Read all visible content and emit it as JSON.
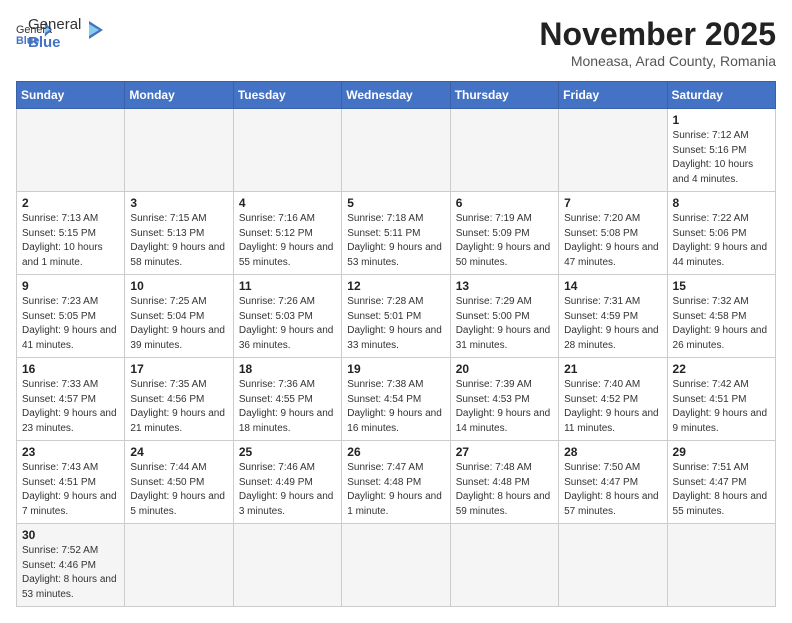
{
  "header": {
    "logo_general": "General",
    "logo_blue": "Blue",
    "month_title": "November 2025",
    "subtitle": "Moneasa, Arad County, Romania"
  },
  "weekdays": [
    "Sunday",
    "Monday",
    "Tuesday",
    "Wednesday",
    "Thursday",
    "Friday",
    "Saturday"
  ],
  "weeks": [
    [
      {
        "day": "",
        "info": ""
      },
      {
        "day": "",
        "info": ""
      },
      {
        "day": "",
        "info": ""
      },
      {
        "day": "",
        "info": ""
      },
      {
        "day": "",
        "info": ""
      },
      {
        "day": "",
        "info": ""
      },
      {
        "day": "1",
        "info": "Sunrise: 7:12 AM\nSunset: 5:16 PM\nDaylight: 10 hours\nand 4 minutes."
      }
    ],
    [
      {
        "day": "2",
        "info": "Sunrise: 7:13 AM\nSunset: 5:15 PM\nDaylight: 10 hours\nand 1 minute."
      },
      {
        "day": "3",
        "info": "Sunrise: 7:15 AM\nSunset: 5:13 PM\nDaylight: 9 hours\nand 58 minutes."
      },
      {
        "day": "4",
        "info": "Sunrise: 7:16 AM\nSunset: 5:12 PM\nDaylight: 9 hours\nand 55 minutes."
      },
      {
        "day": "5",
        "info": "Sunrise: 7:18 AM\nSunset: 5:11 PM\nDaylight: 9 hours\nand 53 minutes."
      },
      {
        "day": "6",
        "info": "Sunrise: 7:19 AM\nSunset: 5:09 PM\nDaylight: 9 hours\nand 50 minutes."
      },
      {
        "day": "7",
        "info": "Sunrise: 7:20 AM\nSunset: 5:08 PM\nDaylight: 9 hours\nand 47 minutes."
      },
      {
        "day": "8",
        "info": "Sunrise: 7:22 AM\nSunset: 5:06 PM\nDaylight: 9 hours\nand 44 minutes."
      }
    ],
    [
      {
        "day": "9",
        "info": "Sunrise: 7:23 AM\nSunset: 5:05 PM\nDaylight: 9 hours\nand 41 minutes."
      },
      {
        "day": "10",
        "info": "Sunrise: 7:25 AM\nSunset: 5:04 PM\nDaylight: 9 hours\nand 39 minutes."
      },
      {
        "day": "11",
        "info": "Sunrise: 7:26 AM\nSunset: 5:03 PM\nDaylight: 9 hours\nand 36 minutes."
      },
      {
        "day": "12",
        "info": "Sunrise: 7:28 AM\nSunset: 5:01 PM\nDaylight: 9 hours\nand 33 minutes."
      },
      {
        "day": "13",
        "info": "Sunrise: 7:29 AM\nSunset: 5:00 PM\nDaylight: 9 hours\nand 31 minutes."
      },
      {
        "day": "14",
        "info": "Sunrise: 7:31 AM\nSunset: 4:59 PM\nDaylight: 9 hours\nand 28 minutes."
      },
      {
        "day": "15",
        "info": "Sunrise: 7:32 AM\nSunset: 4:58 PM\nDaylight: 9 hours\nand 26 minutes."
      }
    ],
    [
      {
        "day": "16",
        "info": "Sunrise: 7:33 AM\nSunset: 4:57 PM\nDaylight: 9 hours\nand 23 minutes."
      },
      {
        "day": "17",
        "info": "Sunrise: 7:35 AM\nSunset: 4:56 PM\nDaylight: 9 hours\nand 21 minutes."
      },
      {
        "day": "18",
        "info": "Sunrise: 7:36 AM\nSunset: 4:55 PM\nDaylight: 9 hours\nand 18 minutes."
      },
      {
        "day": "19",
        "info": "Sunrise: 7:38 AM\nSunset: 4:54 PM\nDaylight: 9 hours\nand 16 minutes."
      },
      {
        "day": "20",
        "info": "Sunrise: 7:39 AM\nSunset: 4:53 PM\nDaylight: 9 hours\nand 14 minutes."
      },
      {
        "day": "21",
        "info": "Sunrise: 7:40 AM\nSunset: 4:52 PM\nDaylight: 9 hours\nand 11 minutes."
      },
      {
        "day": "22",
        "info": "Sunrise: 7:42 AM\nSunset: 4:51 PM\nDaylight: 9 hours\nand 9 minutes."
      }
    ],
    [
      {
        "day": "23",
        "info": "Sunrise: 7:43 AM\nSunset: 4:51 PM\nDaylight: 9 hours\nand 7 minutes."
      },
      {
        "day": "24",
        "info": "Sunrise: 7:44 AM\nSunset: 4:50 PM\nDaylight: 9 hours\nand 5 minutes."
      },
      {
        "day": "25",
        "info": "Sunrise: 7:46 AM\nSunset: 4:49 PM\nDaylight: 9 hours\nand 3 minutes."
      },
      {
        "day": "26",
        "info": "Sunrise: 7:47 AM\nSunset: 4:48 PM\nDaylight: 9 hours\nand 1 minute."
      },
      {
        "day": "27",
        "info": "Sunrise: 7:48 AM\nSunset: 4:48 PM\nDaylight: 8 hours\nand 59 minutes."
      },
      {
        "day": "28",
        "info": "Sunrise: 7:50 AM\nSunset: 4:47 PM\nDaylight: 8 hours\nand 57 minutes."
      },
      {
        "day": "29",
        "info": "Sunrise: 7:51 AM\nSunset: 4:47 PM\nDaylight: 8 hours\nand 55 minutes."
      }
    ],
    [
      {
        "day": "30",
        "info": "Sunrise: 7:52 AM\nSunset: 4:46 PM\nDaylight: 8 hours\nand 53 minutes."
      },
      {
        "day": "",
        "info": ""
      },
      {
        "day": "",
        "info": ""
      },
      {
        "day": "",
        "info": ""
      },
      {
        "day": "",
        "info": ""
      },
      {
        "day": "",
        "info": ""
      },
      {
        "day": "",
        "info": ""
      }
    ]
  ]
}
